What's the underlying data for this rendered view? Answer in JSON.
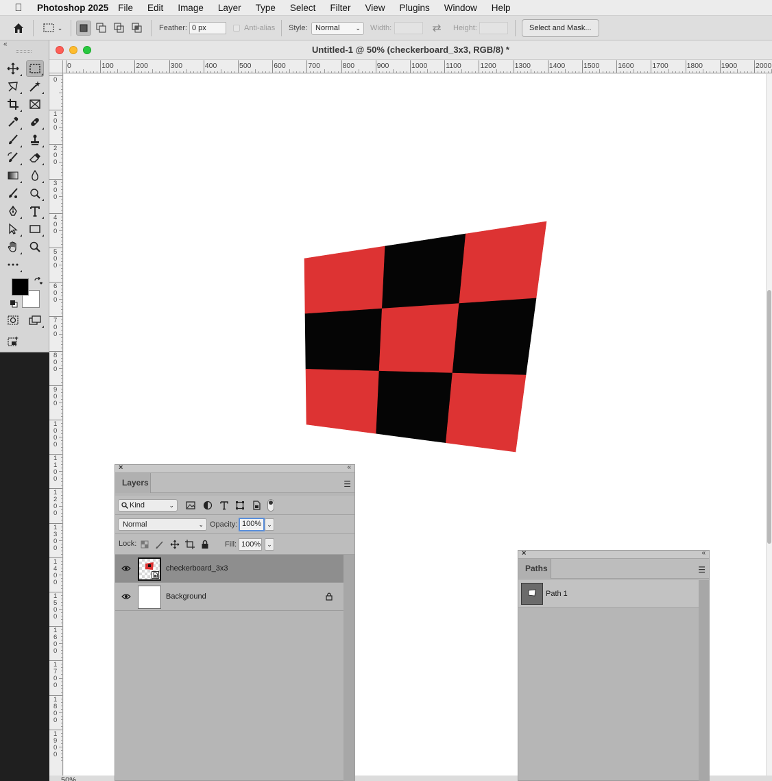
{
  "menubar": {
    "app_name": "Photoshop 2025",
    "items": [
      "File",
      "Edit",
      "Image",
      "Layer",
      "Type",
      "Select",
      "Filter",
      "View",
      "Plugins",
      "Window",
      "Help"
    ]
  },
  "options_bar": {
    "feather_label": "Feather:",
    "feather_value": "0 px",
    "antialias_label": "Anti-alias",
    "style_label": "Style:",
    "style_value": "Normal",
    "width_label": "Width:",
    "height_label": "Height:",
    "select_mask_label": "Select and Mask..."
  },
  "document": {
    "title": "Untitled-1 @ 50% (checkerboard_3x3, RGB/8) *",
    "zoom_status": "50%",
    "hruler_labels": [
      "0",
      "100",
      "200",
      "300",
      "400",
      "500",
      "600",
      "700",
      "800",
      "900",
      "1000",
      "1100",
      "1200",
      "1300",
      "1400",
      "1500",
      "1600",
      "1700",
      "1800",
      "1900",
      "2000"
    ],
    "vruler_labels": [
      "0",
      "100",
      "200",
      "300",
      "400",
      "500",
      "600",
      "700",
      "800",
      "900",
      "1000",
      "1100",
      "1200",
      "1300",
      "1400",
      "1500",
      "1600",
      "1700",
      "1800",
      "1900"
    ],
    "checkerboard": {
      "rows": 3,
      "cols": 3,
      "color_a": "#dd3333",
      "color_b": "#050505"
    }
  },
  "colors": {
    "foreground": "#000000",
    "background": "#ffffff"
  },
  "layers_panel": {
    "tab": "Layers",
    "filter_kind": "Kind",
    "blend_mode": "Normal",
    "opacity_label": "Opacity:",
    "opacity_value": "100%",
    "lock_label": "Lock:",
    "fill_label": "Fill:",
    "fill_value": "100%",
    "layers": [
      {
        "name": "checkerboard_3x3",
        "selected": true,
        "locked": false,
        "visible": true
      },
      {
        "name": "Background",
        "selected": false,
        "locked": true,
        "visible": true
      }
    ]
  },
  "paths_panel": {
    "tab": "Paths",
    "paths": [
      {
        "name": "Path 1"
      }
    ]
  }
}
